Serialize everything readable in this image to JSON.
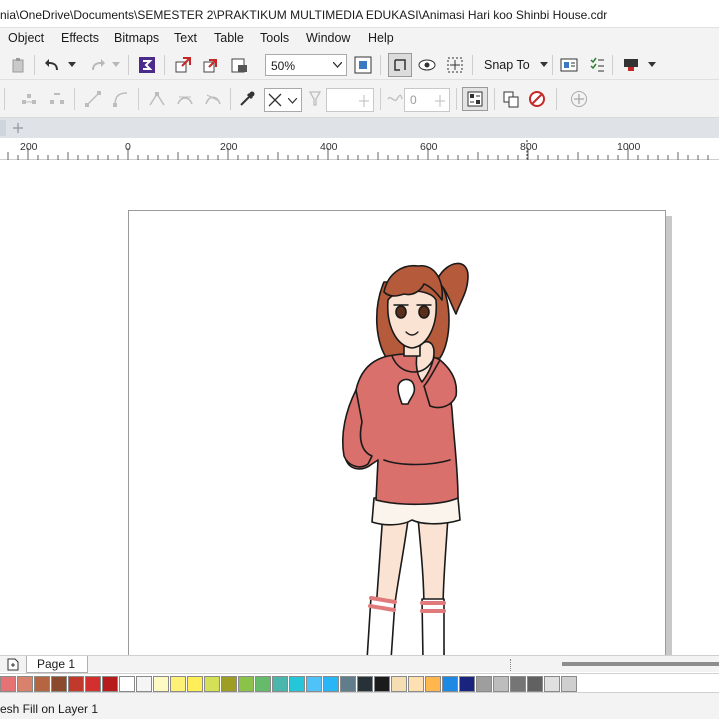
{
  "window": {
    "title": "nia\\OneDrive\\Documents\\SEMESTER 2\\PRAKTIKUM MULTIMEDIA EDUKASI\\Animasi Hari koo Shinbi House.cdr"
  },
  "menu": {
    "items": [
      "Object",
      "Effects",
      "Bitmaps",
      "Text",
      "Table",
      "Tools",
      "Window",
      "Help"
    ]
  },
  "toolbar": {
    "zoom_value": "50%",
    "snap_label": "Snap To",
    "offset_value": "0"
  },
  "ruler": {
    "labels": [
      "200",
      "0",
      "200",
      "400",
      "600",
      "800",
      "1000"
    ]
  },
  "document": {
    "page_tab_label": "Page 1"
  },
  "palette": {
    "colors": [
      "#e57373",
      "#d9826b",
      "#b5653f",
      "#8b4a2b",
      "#c0392b",
      "#d32f2f",
      "#b71c1c",
      "#ffffff",
      "#f5f5f5",
      "#fff9c4",
      "#fff176",
      "#ffee58",
      "#d4e157",
      "#9e9d24",
      "#8bc34a",
      "#66bb6a",
      "#4db6ac",
      "#26c6da",
      "#4fc3f7",
      "#29b6f6",
      "#607d8b",
      "#263238",
      "#1b1b1b",
      "#f5deb3",
      "#ffe0b2",
      "#ffb74d",
      "#1e88e5",
      "#1a237e",
      "#9e9e9e",
      "#bdbdbd",
      "#757575",
      "#616161",
      "#e0e0e0",
      "#cfcfcf"
    ]
  },
  "status": {
    "text": "esh Fill on Layer 1"
  }
}
